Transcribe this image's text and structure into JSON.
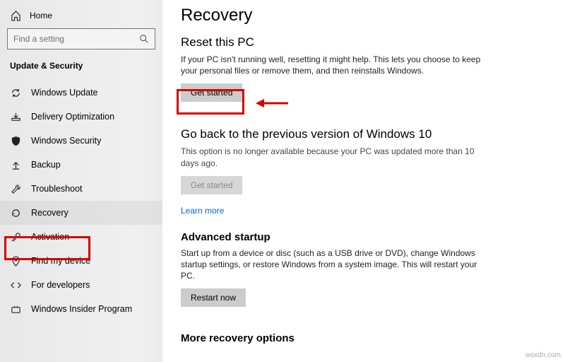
{
  "sidebar": {
    "home": "Home",
    "search_placeholder": "Find a setting",
    "category": "Update & Security",
    "items": [
      {
        "label": "Windows Update"
      },
      {
        "label": "Delivery Optimization"
      },
      {
        "label": "Windows Security"
      },
      {
        "label": "Backup"
      },
      {
        "label": "Troubleshoot"
      },
      {
        "label": "Recovery"
      },
      {
        "label": "Activation"
      },
      {
        "label": "Find my device"
      },
      {
        "label": "For developers"
      },
      {
        "label": "Windows Insider Program"
      }
    ]
  },
  "page": {
    "title": "Recovery",
    "reset": {
      "heading": "Reset this PC",
      "desc": "If your PC isn't running well, resetting it might help. This lets you choose to keep your personal files or remove them, and then reinstalls Windows.",
      "button": "Get started"
    },
    "goback": {
      "heading": "Go back to the previous version of Windows 10",
      "desc": "This option is no longer available because your PC was updated more than 10 days ago.",
      "button": "Get started",
      "link": "Learn more"
    },
    "advanced": {
      "heading": "Advanced startup",
      "desc": "Start up from a device or disc (such as a USB drive or DVD), change Windows startup settings, or restore Windows from a system image. This will restart your PC.",
      "button": "Restart now"
    },
    "more": {
      "heading": "More recovery options"
    }
  },
  "watermark": "wsxdn.com"
}
